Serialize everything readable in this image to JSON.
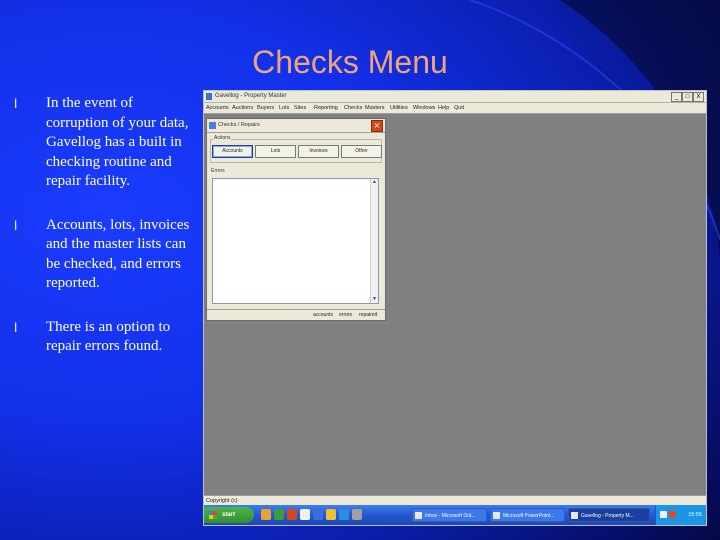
{
  "slide": {
    "title": "Checks Menu",
    "bullets": [
      {
        "text": "In the event of corruption of your data, Gavellog has a built in checking routine and repair facility."
      },
      {
        "text": "Accounts, lots, invoices and the master lists can be checked, and errors reported."
      },
      {
        "text": "There is an option to repair errors found."
      }
    ],
    "bullet_glyph": "l"
  },
  "screenshot": {
    "window_title": "Gavellog - Property Master",
    "window_buttons": [
      "_",
      "□",
      "X"
    ],
    "menu": [
      "Accounts",
      "Auctions",
      "Buyers",
      "Lots",
      "Sites",
      "Reporting",
      "Checks",
      "Masters",
      "Utilities",
      "Windows",
      "Help",
      "Quit"
    ],
    "dialog": {
      "title": "Checks / Repairs",
      "close": "×",
      "group_actions": "Actions",
      "buttons": [
        "Accounts",
        "Lots",
        "Invoices",
        "Other"
      ],
      "group_errors": "Errors",
      "status_cells": [
        "accounts",
        "errors",
        "repaired"
      ]
    },
    "status_bar": "Copyright (c)",
    "taskbar": {
      "start": "start",
      "tasks": [
        "Inbox - Microsoft Out...",
        "Microsoft PowerPoint...",
        "Gavellog - Property M..."
      ],
      "clock": "15:55"
    }
  },
  "colors": {
    "title": "#f0a47a",
    "background": "#1230e8",
    "bullet_text": "#ffffff"
  }
}
